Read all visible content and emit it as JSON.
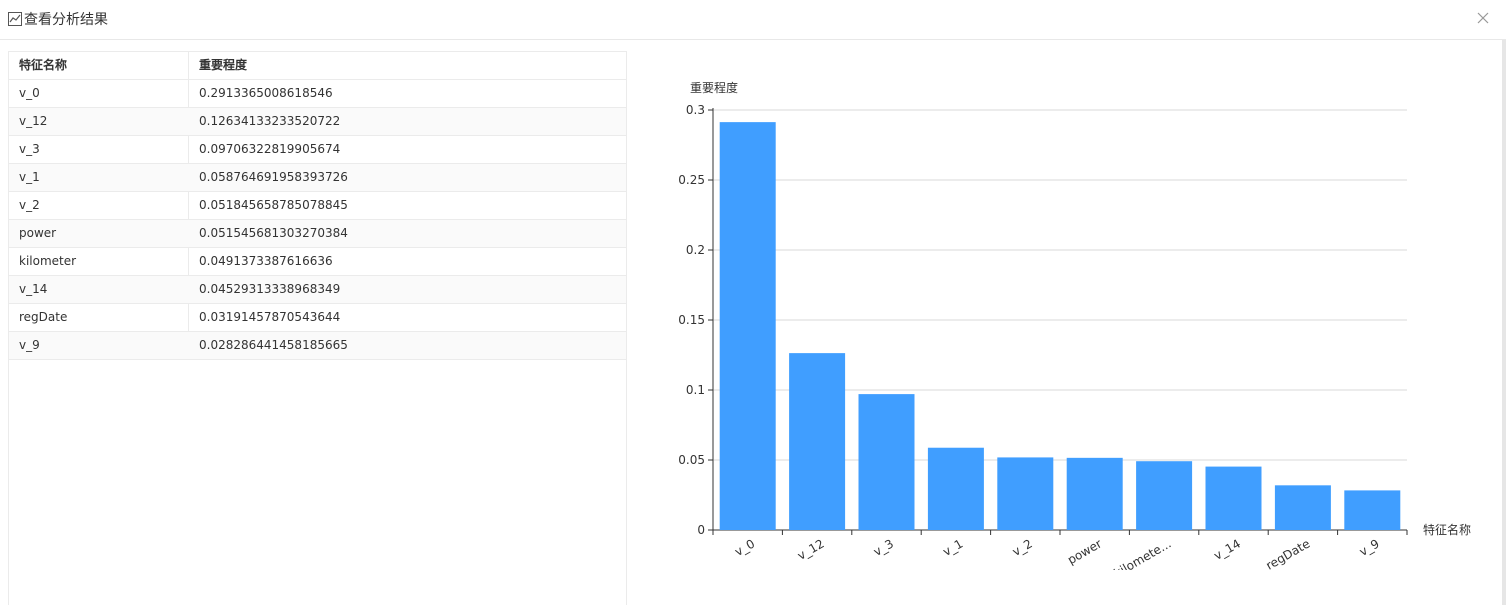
{
  "dialog": {
    "title": "查看分析结果",
    "close_icon": "close-icon",
    "chart_icon": "line-chart-icon"
  },
  "table": {
    "headers": [
      "特征名称",
      "重要程度"
    ],
    "rows": [
      [
        "v_0",
        "0.2913365008618546"
      ],
      [
        "v_12",
        "0.12634133233520722"
      ],
      [
        "v_3",
        "0.09706322819905674"
      ],
      [
        "v_1",
        "0.058764691958393726"
      ],
      [
        "v_2",
        "0.051845658785078845"
      ],
      [
        "power",
        "0.051545681303270384"
      ],
      [
        "kilometer",
        "0.0491373387616636"
      ],
      [
        "v_14",
        "0.04529313338968349"
      ],
      [
        "regDate",
        "0.03191457870543644"
      ],
      [
        "v_9",
        "0.028286441458185665"
      ]
    ]
  },
  "chart_data": {
    "type": "bar",
    "categories": [
      "v_0",
      "v_12",
      "v_3",
      "v_1",
      "v_2",
      "power",
      "kilomete...",
      "v_14",
      "regDate",
      "v_9"
    ],
    "values": [
      0.2913365008618546,
      0.12634133233520722,
      0.09706322819905674,
      0.058764691958393726,
      0.051845658785078845,
      0.051545681303270384,
      0.0491373387616636,
      0.04529313338968349,
      0.03191457870543644,
      0.028286441458185665
    ],
    "ylabel": "重要程度",
    "xlabel": "特征名称",
    "ylim": [
      0,
      0.3
    ],
    "yticks": [
      0,
      0.05,
      0.1,
      0.15,
      0.2,
      0.25,
      0.3
    ],
    "ytick_labels": [
      "0",
      "0.05",
      "0.1",
      "0.15",
      "0.2",
      "0.25",
      "0.3"
    ],
    "bar_color": "#409eff",
    "grid": true
  }
}
